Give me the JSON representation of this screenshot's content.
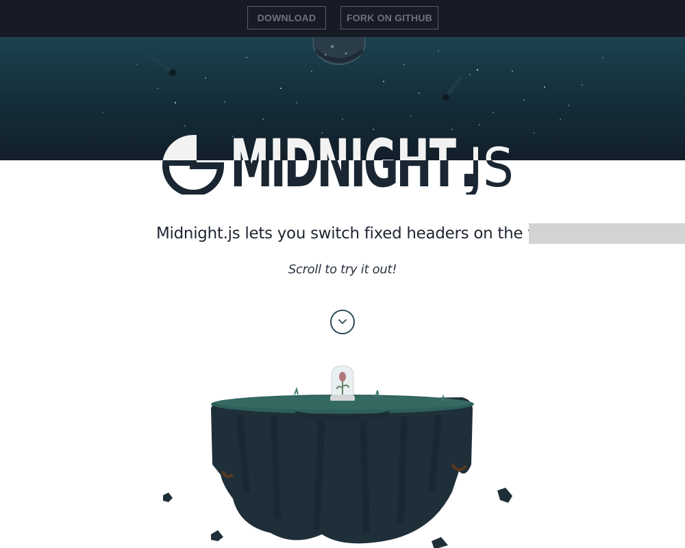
{
  "nav": {
    "download_label": "DOWNLOAD",
    "fork_label": "FORK ON GITHUB"
  },
  "logo": {
    "text_main": "MIDNIGHT",
    "text_dot": ".",
    "text_suffix": "JS"
  },
  "content": {
    "tagline": "Midnight.js lets you switch fixed headers on the fly",
    "scroll_hint": "Scroll to try it out!"
  },
  "icons": {
    "scroll": "chevron-down-icon",
    "logo_mark": "half-moon-icon"
  },
  "colors": {
    "header_bg": "#171b26",
    "hero_top": "#1d4250",
    "hero_bottom": "#121e29",
    "logo_dark": "#1a2733",
    "logo_light": "#f2f2f2",
    "text": "#1e2530",
    "accent": "#2c4a56"
  }
}
